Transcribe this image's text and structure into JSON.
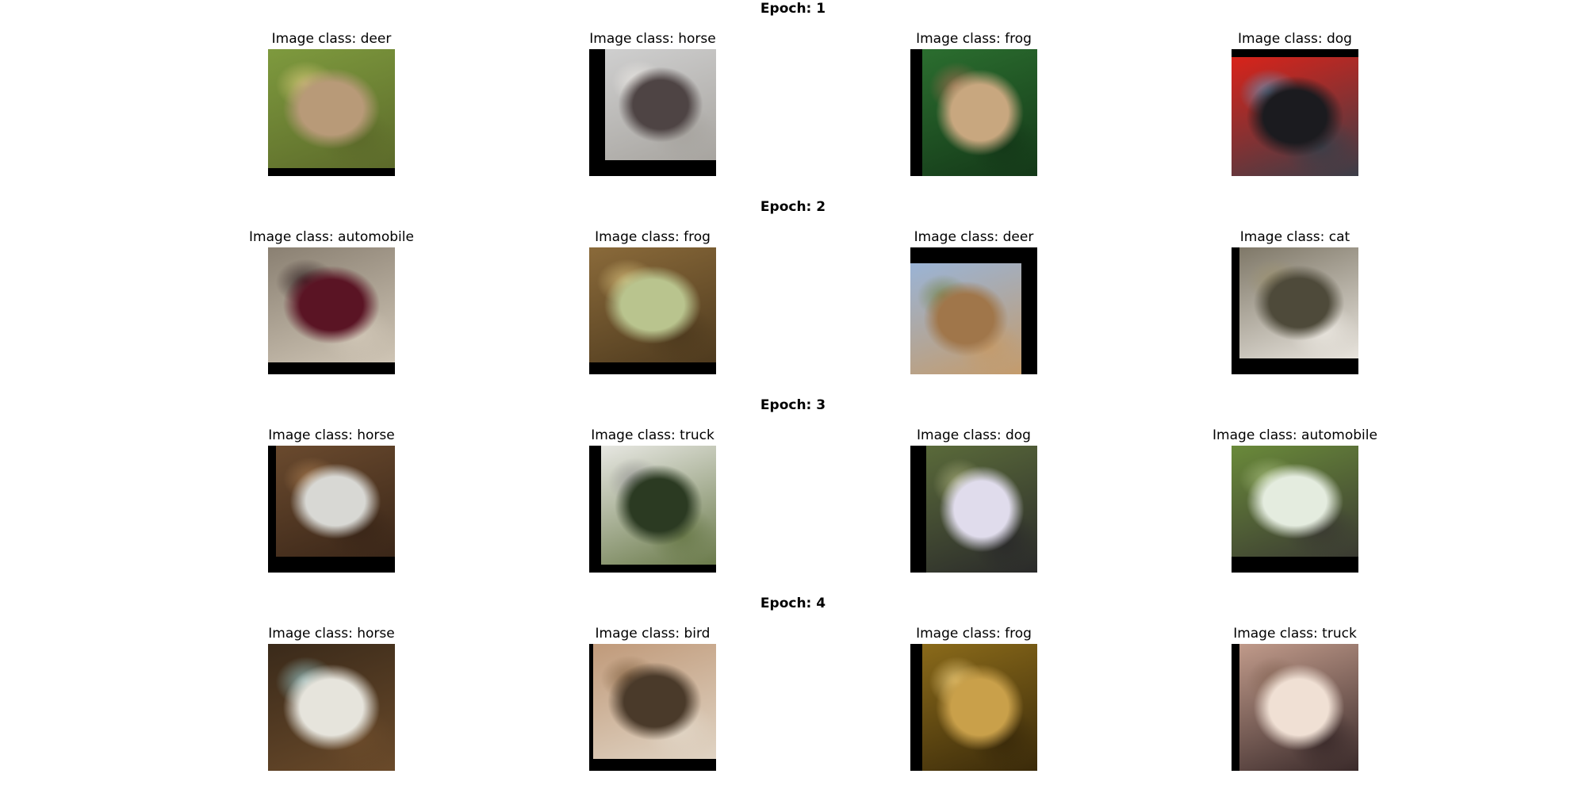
{
  "caption_prefix": "Image class: ",
  "epochs": [
    {
      "title": "Epoch: 1",
      "images": [
        {
          "class_name": "deer",
          "label": "Image class: deer",
          "colors": [
            "#7e9a3e",
            "#b89a78",
            "#5c6a2a",
            "#c9c070"
          ]
        },
        {
          "class_name": "horse",
          "label": "Image class: horse",
          "colors": [
            "#cfcfcf",
            "#4e4444",
            "#a7a49f",
            "#e6e3df"
          ]
        },
        {
          "class_name": "frog",
          "label": "Image class: frog",
          "colors": [
            "#2b6e2f",
            "#c8a77f",
            "#143818",
            "#8f6a4a"
          ]
        },
        {
          "class_name": "dog",
          "label": "Image class: dog",
          "colors": [
            "#d9231a",
            "#1b1b1f",
            "#3b3e48",
            "#6e88a8"
          ]
        }
      ]
    },
    {
      "title": "Epoch: 2",
      "images": [
        {
          "class_name": "automobile",
          "label": "Image class: automobile",
          "colors": [
            "#8a8072",
            "#5a1424",
            "#cfc5b5",
            "#3a2a2a"
          ]
        },
        {
          "class_name": "frog",
          "label": "Image class: frog",
          "colors": [
            "#8a6a3a",
            "#b9c48e",
            "#4e3a1e",
            "#c9b070"
          ]
        },
        {
          "class_name": "deer",
          "label": "Image class: deer",
          "colors": [
            "#9ab4d6",
            "#a0764a",
            "#c49b6b",
            "#7a8a5a"
          ]
        },
        {
          "class_name": "cat",
          "label": "Image class: cat",
          "colors": [
            "#7f7868",
            "#4e4a3a",
            "#e8e4dd",
            "#9a9070"
          ]
        }
      ]
    },
    {
      "title": "Epoch: 3",
      "images": [
        {
          "class_name": "horse",
          "label": "Image class: horse",
          "colors": [
            "#6a4a2e",
            "#d8d8d4",
            "#3a2618",
            "#9a7048"
          ]
        },
        {
          "class_name": "truck",
          "label": "Image class: truck",
          "colors": [
            "#e7e7e2",
            "#2b3a22",
            "#6a7a4a",
            "#9a9a98"
          ]
        },
        {
          "class_name": "dog",
          "label": "Image class: dog",
          "colors": [
            "#5a6a3a",
            "#e0dcec",
            "#2a2a2a",
            "#9aa070"
          ]
        },
        {
          "class_name": "automobile",
          "label": "Image class: automobile",
          "colors": [
            "#6a8a3a",
            "#e4ecdf",
            "#3a3a32",
            "#9ab070"
          ]
        }
      ]
    },
    {
      "title": "Epoch: 4",
      "images": [
        {
          "class_name": "horse",
          "label": "Image class: horse",
          "colors": [
            "#3a2a1a",
            "#e6e4dc",
            "#6a4a2a",
            "#8ab0b0"
          ]
        },
        {
          "class_name": "bird",
          "label": "Image class: bird",
          "colors": [
            "#c09a7a",
            "#4a3a2a",
            "#e0d4c4",
            "#8a6a4a"
          ]
        },
        {
          "class_name": "frog",
          "label": "Image class: frog",
          "colors": [
            "#8a6a1a",
            "#c9a04a",
            "#3a2a0a",
            "#e0c070"
          ]
        },
        {
          "class_name": "truck",
          "label": "Image class: truck",
          "colors": [
            "#c09a8a",
            "#f0e0d4",
            "#3a2a2a",
            "#8a6a5a"
          ]
        }
      ]
    }
  ]
}
